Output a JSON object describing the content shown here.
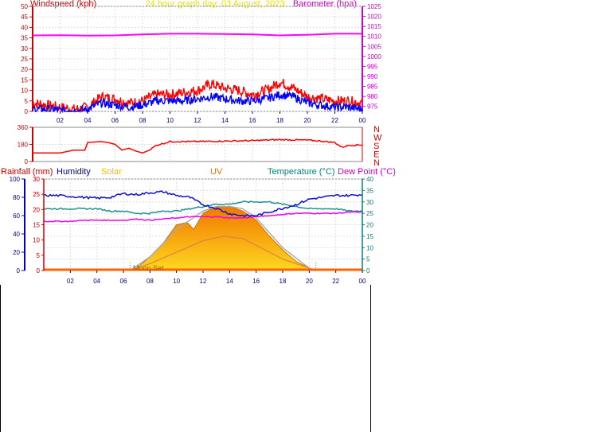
{
  "chart_data": [
    {
      "type": "line",
      "panel": "wind-barometer",
      "title": "24 hour graph day: 03 August, 2023",
      "left_axis_label": "Windspeed (kph)",
      "right_axis_label": "Barometer (hpa)",
      "left_ylim": [
        0,
        50
      ],
      "left_ticks": [
        "0",
        "5",
        "10",
        "15",
        "20",
        "25",
        "30",
        "35",
        "40",
        "45",
        "50"
      ],
      "right_ylim": [
        972.5,
        1025
      ],
      "right_ticks": [
        "975",
        "980",
        "985",
        "990",
        "995",
        "1000",
        "1005",
        "1010",
        "1015",
        "1020",
        "1025"
      ],
      "x_ticks": [
        "02",
        "04",
        "06",
        "08",
        "10",
        "12",
        "14",
        "16",
        "18",
        "20",
        "22",
        "00"
      ],
      "grid": true,
      "colors": {
        "wind_gust": "#ff0000",
        "wind_avg": "#0000ff",
        "barometer": "#ff00ff",
        "title": "#e8e000",
        "left_axis": "#cc0000",
        "right_axis": "#cc00cc",
        "x_ticks": "#000080"
      },
      "series": [
        {
          "name": "Barometer",
          "axis": "right",
          "x": [
            0,
            2,
            4,
            6,
            8,
            10,
            12,
            14,
            16,
            18,
            20,
            22,
            24
          ],
          "values": [
            1010.5,
            1010.6,
            1010.4,
            1010.5,
            1011,
            1011.3,
            1011.3,
            1011.2,
            1011,
            1010.5,
            1010.8,
            1011.3,
            1011.3
          ]
        },
        {
          "name": "Wind gust",
          "axis": "left",
          "x": [
            0,
            1,
            2,
            3,
            4,
            5,
            6,
            7,
            8,
            9,
            10,
            11,
            12,
            13,
            14,
            15,
            16,
            17,
            18,
            19,
            20,
            21,
            22,
            23,
            24
          ],
          "values": [
            4,
            3,
            2,
            1,
            2,
            7,
            6,
            4,
            5,
            8,
            8,
            9,
            10,
            13,
            11,
            10,
            8,
            10,
            14,
            11,
            7,
            6,
            5,
            5,
            4
          ]
        },
        {
          "name": "Wind average",
          "axis": "left",
          "x": [
            0,
            1,
            2,
            3,
            4,
            5,
            6,
            7,
            8,
            9,
            10,
            11,
            12,
            13,
            14,
            15,
            16,
            17,
            18,
            19,
            20,
            21,
            22,
            23,
            24
          ],
          "values": [
            1,
            1,
            0.5,
            0,
            1,
            4,
            3,
            2,
            3,
            5,
            5,
            5,
            6,
            7,
            6,
            5,
            5,
            6,
            8,
            7,
            4,
            3,
            2,
            2,
            1
          ]
        }
      ]
    },
    {
      "type": "line",
      "panel": "wind-direction",
      "ylim": [
        0,
        360
      ],
      "y_ticks": [
        "360",
        "180",
        "0"
      ],
      "direction_labels": [
        "N",
        "W",
        "S",
        "E",
        "N"
      ],
      "colors": {
        "line": "#ff0000",
        "axis": "#cc0000"
      },
      "series": [
        {
          "name": "Wind direction",
          "x": [
            0,
            1,
            2,
            3,
            3.3,
            3.8,
            4,
            5,
            5.5,
            6,
            6.5,
            7,
            7.5,
            8,
            8.5,
            9,
            10,
            12,
            14,
            16,
            18,
            20,
            21,
            22,
            22.5,
            23,
            24
          ],
          "values": [
            90,
            90,
            90,
            120,
            120,
            120,
            200,
            210,
            200,
            180,
            120,
            140,
            110,
            90,
            120,
            170,
            210,
            210,
            215,
            220,
            230,
            225,
            215,
            200,
            150,
            170,
            175
          ]
        }
      ]
    },
    {
      "type": "area",
      "panel": "rain-humidity-solar-uv-temperature-dewpoint",
      "legend": [
        "Rainfall (mm)",
        "Humidity",
        "Solar",
        "UV",
        "Temperature (°C)",
        "Dew Point (°C)"
      ],
      "legend_colors": [
        "#cc0000",
        "#000099",
        "#e8c000",
        "#e87000",
        "#008080",
        "#cc00cc"
      ],
      "humidity_ylim": [
        0,
        100
      ],
      "humidity_ticks": [
        "0",
        "20",
        "40",
        "60",
        "80",
        "100"
      ],
      "rain_ylim": [
        0,
        30
      ],
      "rain_ticks": [
        "0",
        "5",
        "10",
        "15",
        "20",
        "25",
        "30"
      ],
      "temp_ylim": [
        0,
        40
      ],
      "temp_ticks": [
        "0",
        "5",
        "10",
        "15",
        "20",
        "25",
        "30",
        "35",
        "40"
      ],
      "x_ticks": [
        "02",
        "04",
        "06",
        "08",
        "10",
        "12",
        "14",
        "16",
        "18",
        "20",
        "22",
        "00"
      ],
      "annotation": "Moon Set",
      "moon_set_x": 6.5,
      "moon_rise_x": 20.5,
      "series": [
        {
          "name": "Humidity",
          "axis": "humidity",
          "color": "#1010cc",
          "x": [
            0,
            1,
            2,
            3,
            4,
            5,
            6,
            7,
            8,
            9,
            10,
            11,
            12,
            13,
            14,
            15,
            16,
            17,
            18,
            19,
            20,
            21,
            22,
            23,
            24
          ],
          "values": [
            82,
            82,
            81,
            80,
            79,
            80,
            84,
            83,
            85,
            86,
            82,
            80,
            72,
            68,
            62,
            60,
            60,
            64,
            68,
            72,
            78,
            80,
            82,
            82,
            83
          ]
        },
        {
          "name": "Temperature (°C)",
          "axis": "temp",
          "color": "#209090",
          "x": [
            0,
            1,
            2,
            3,
            4,
            5,
            6,
            7,
            8,
            9,
            10,
            11,
            12,
            13,
            14,
            15,
            16,
            17,
            18,
            19,
            20,
            21,
            22,
            23,
            24
          ],
          "values": [
            27,
            27,
            27,
            27,
            27,
            26,
            26,
            25,
            25,
            26,
            26,
            27,
            28,
            29,
            29,
            30,
            30,
            30,
            29,
            28,
            27,
            27,
            27,
            26,
            26
          ]
        },
        {
          "name": "Dew Point (°C)",
          "axis": "temp",
          "color": "#ee00ee",
          "x": [
            0,
            1,
            2,
            3,
            4,
            5,
            6,
            7,
            8,
            9,
            10,
            11,
            12,
            13,
            14,
            15,
            16,
            17,
            18,
            19,
            20,
            21,
            22,
            23,
            24
          ],
          "values": [
            21.5,
            21.5,
            21.5,
            22,
            22,
            22,
            22,
            22.5,
            22,
            22.5,
            23,
            23.5,
            23.5,
            23.5,
            23,
            23,
            23.5,
            24,
            24.5,
            25,
            25,
            25,
            25,
            25.5,
            25.5
          ]
        },
        {
          "name": "Solar",
          "axis": "temp",
          "color": "#ffb000",
          "x": [
            6.5,
            7,
            8,
            9,
            10,
            10.8,
            11.3,
            12,
            13,
            14,
            15,
            16,
            17,
            18,
            19,
            20,
            20.5
          ],
          "values": [
            0,
            1,
            6,
            12,
            20,
            21,
            18,
            25,
            28,
            28,
            26,
            22,
            15,
            9,
            4,
            1,
            0
          ]
        },
        {
          "name": "Solar max",
          "axis": "temp",
          "color": "#a8a8a8",
          "x": [
            6.5,
            8,
            10,
            12,
            13,
            14,
            15,
            16,
            18,
            20,
            20.5
          ],
          "values": [
            0,
            6,
            18,
            26,
            28,
            28,
            27,
            23,
            10,
            1,
            0
          ]
        },
        {
          "name": "UV",
          "axis": "temp",
          "color": "#e08040",
          "x": [
            6.5,
            8,
            10,
            12,
            13.5,
            15,
            16,
            18,
            20,
            20.5
          ],
          "values": [
            0,
            3,
            8,
            13,
            15,
            14,
            11,
            5,
            1,
            0
          ]
        }
      ]
    }
  ]
}
